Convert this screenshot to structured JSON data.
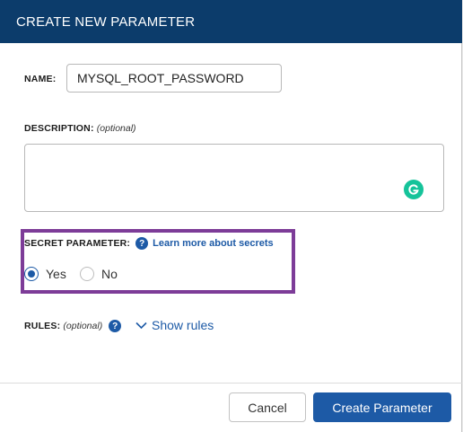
{
  "dialog": {
    "title": "CREATE NEW PARAMETER"
  },
  "name_field": {
    "label": "NAME:",
    "value": "MYSQL_ROOT_PASSWORD"
  },
  "description_field": {
    "label": "DESCRIPTION:",
    "optional": "(optional)",
    "value": "",
    "grammarly_icon": "grammarly-icon"
  },
  "secret": {
    "label": "SECRET PARAMETER:",
    "help_icon": "question-icon",
    "help_glyph": "?",
    "learn_more": "Learn more about secrets",
    "highlight_color": "#7d3c98",
    "options": [
      {
        "label": "Yes",
        "selected": true
      },
      {
        "label": "No",
        "selected": false
      }
    ]
  },
  "rules": {
    "label": "RULES:",
    "optional": "(optional)",
    "help_glyph": "?",
    "show_rules": "Show rules"
  },
  "footer": {
    "cancel_label": "Cancel",
    "create_label": "Create Parameter"
  },
  "colors": {
    "header_bg": "#0c3c6b",
    "accent": "#1d5aa6",
    "grammarly": "#15c39a"
  }
}
